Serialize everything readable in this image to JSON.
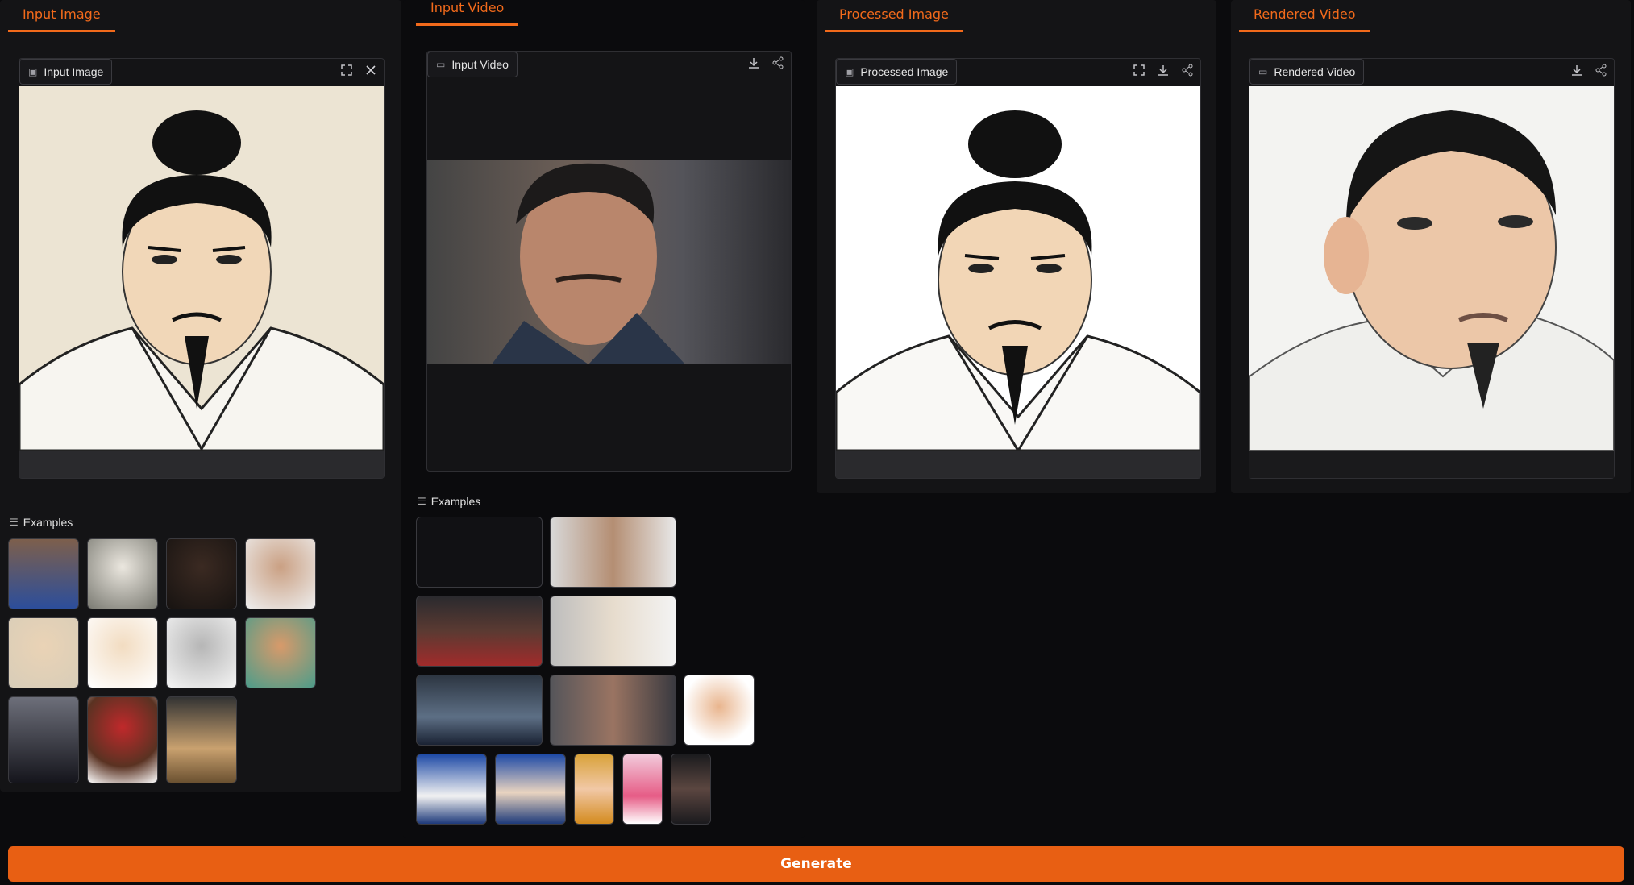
{
  "tabs": {
    "input_image": "Input Image",
    "input_video": "Input Video",
    "processed_image": "Processed Image",
    "rendered_video": "Rendered Video"
  },
  "panels": {
    "input_image_label": "Input Image",
    "input_video_label": "Input Video",
    "processed_image_label": "Processed Image",
    "rendered_video_label": "Rendered Video"
  },
  "examples": {
    "image_label": "Examples",
    "video_label": "Examples"
  },
  "icons": {
    "image": "image-icon",
    "video": "video-icon",
    "fullscreen": "fullscreen-icon",
    "close": "close-icon",
    "download": "download-icon",
    "share": "share-icon",
    "list": "list-icon"
  },
  "colors": {
    "accent": "#f26a1b",
    "button": "#e85f13",
    "background": "#0b0b0d",
    "panel": "#141416"
  },
  "generate_button": "Generate"
}
